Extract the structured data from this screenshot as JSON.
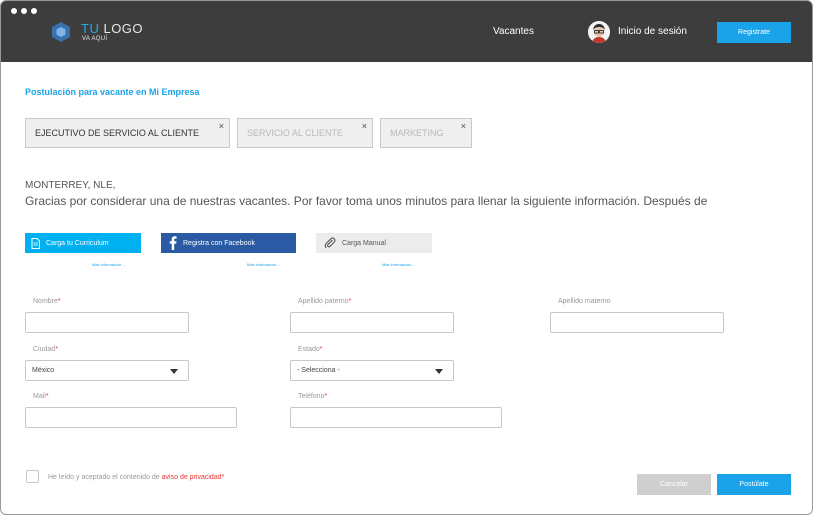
{
  "header": {
    "logo_title_a": "TU",
    "logo_title_b": "LOGO",
    "logo_sub": "VA AQUÍ",
    "nav_vacantes": "Vacantes",
    "nav_login": "Inicio de sesión",
    "register_label": "Registrate"
  },
  "page": {
    "section_title": "Postulación para vacante en Mi Empresa",
    "tags": [
      {
        "label": "EJECUTIVO DE SERVICIO AL CLIENTE",
        "close": "×"
      },
      {
        "label": "SERVICIO AL CLIENTE",
        "close": "×"
      },
      {
        "label": "MARKETING",
        "close": "×"
      }
    ],
    "location": "MONTERREY, NLE,",
    "intro": "Gracias por considerar una de nuestras vacantes. Por favor toma unos minutos para llenar la siguiente información. Después de"
  },
  "upload": {
    "cv_label": "Carga tu Curriculum",
    "fb_label": "Registra con Facebook",
    "manual_label": "Carga Manual",
    "more_info": "Más información..."
  },
  "form": {
    "nombre_label": "Nombre",
    "apellido_paterno_label": "Apellido paterno",
    "apellido_materno_label": "Apellido materno",
    "ciudad_label": "Ciudad",
    "ciudad_value": "México",
    "estado_label": "Estado",
    "estado_value": "- Selecciona -",
    "mail_label": "Mail",
    "telefono_label": "Teléfono",
    "required_mark": "*"
  },
  "footer": {
    "terms_prefix": "He leído y aceptado el contenido de",
    "terms_link": "aviso de privacidad",
    "terms_req": "*",
    "cancel_label": "Cancelar",
    "apply_label": "Postúlate"
  },
  "colors": {
    "accent": "#1aa3e8",
    "facebook": "#2a5aa4",
    "header_bg": "#3d3d3d",
    "required": "#e53935"
  }
}
